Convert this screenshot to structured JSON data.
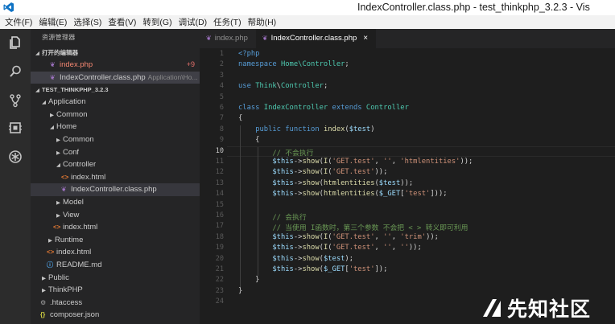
{
  "window": {
    "title": "IndexController.class.php - test_thinkphp_3.2.3 - Vis"
  },
  "menu": [
    "文件(F)",
    "编辑(E)",
    "选择(S)",
    "查看(V)",
    "转到(G)",
    "调试(D)",
    "任务(T)",
    "帮助(H)"
  ],
  "activity_bar": [
    {
      "icon": "files-icon"
    },
    {
      "icon": "search-icon"
    },
    {
      "icon": "source-control-icon"
    },
    {
      "icon": "debug-icon"
    },
    {
      "icon": "extensions-icon"
    }
  ],
  "sidebar": {
    "header": "资源管理器",
    "open_editors": {
      "label": "打开的编辑器",
      "items": [
        {
          "name": "index.php",
          "badge": "9",
          "desc": ""
        },
        {
          "name": "IndexController.class.php",
          "badge": "",
          "desc": "Application\\Ho..."
        }
      ]
    },
    "project": {
      "label": "TEST_THINKPHP_3.2.3",
      "tree": [
        {
          "name": "Application",
          "depth": 1,
          "type": "folder-open"
        },
        {
          "name": "Common",
          "depth": 2,
          "type": "folder"
        },
        {
          "name": "Home",
          "depth": 2,
          "type": "folder-open"
        },
        {
          "name": "Common",
          "depth": 3,
          "type": "folder"
        },
        {
          "name": "Conf",
          "depth": 3,
          "type": "folder"
        },
        {
          "name": "Controller",
          "depth": 3,
          "type": "folder-open"
        },
        {
          "name": "index.html",
          "depth": 4,
          "type": "html"
        },
        {
          "name": "IndexController.class.php",
          "depth": 4,
          "type": "php",
          "selected": true
        },
        {
          "name": "Model",
          "depth": 3,
          "type": "folder"
        },
        {
          "name": "View",
          "depth": 3,
          "type": "folder"
        },
        {
          "name": "index.html",
          "depth": 3,
          "type": "html"
        },
        {
          "name": "Runtime",
          "depth": 2,
          "type": "folder"
        },
        {
          "name": "index.html",
          "depth": 2,
          "type": "html"
        },
        {
          "name": "README.md",
          "depth": 2,
          "type": "info"
        },
        {
          "name": "Public",
          "depth": 1,
          "type": "folder"
        },
        {
          "name": "ThinkPHP",
          "depth": 1,
          "type": "folder"
        },
        {
          "name": ".htaccess",
          "depth": 1,
          "type": "gear"
        },
        {
          "name": "composer.json",
          "depth": 1,
          "type": "json"
        }
      ]
    }
  },
  "tabs": [
    {
      "label": "index.php",
      "active": false
    },
    {
      "label": "IndexController.class.php",
      "active": true,
      "close": "×"
    }
  ],
  "editor": {
    "current_line": 10,
    "lines": [
      [
        [
          "k",
          "<?php"
        ]
      ],
      [
        [
          "k",
          "namespace "
        ],
        [
          "n",
          "Home\\Controller"
        ],
        [
          "t",
          ";"
        ]
      ],
      [],
      [
        [
          "k",
          "use "
        ],
        [
          "n",
          "Think"
        ],
        [
          "t",
          "\\"
        ],
        [
          "n",
          "Controller"
        ],
        [
          "t",
          ";"
        ]
      ],
      [],
      [
        [
          "k",
          "class "
        ],
        [
          "n",
          "IndexController "
        ],
        [
          "k",
          "extends "
        ],
        [
          "n",
          "Controller"
        ]
      ],
      [
        [
          "t",
          "{"
        ]
      ],
      [
        [
          "t",
          "    "
        ],
        [
          "k",
          "public function "
        ],
        [
          "f",
          "index"
        ],
        [
          "t",
          "("
        ],
        [
          "v",
          "$test"
        ],
        [
          "t",
          ")"
        ]
      ],
      [
        [
          "t",
          "    {"
        ]
      ],
      [
        [
          "t",
          "        "
        ],
        [
          "c",
          "// 不会执行"
        ]
      ],
      [
        [
          "t",
          "        "
        ],
        [
          "v",
          "$this"
        ],
        [
          "t",
          "->"
        ],
        [
          "f",
          "show"
        ],
        [
          "t",
          "("
        ],
        [
          "f",
          "I"
        ],
        [
          "t",
          "("
        ],
        [
          "s",
          "'GET.test'"
        ],
        [
          "t",
          ", "
        ],
        [
          "s",
          "''"
        ],
        [
          "t",
          ", "
        ],
        [
          "s",
          "'htmlentities'"
        ],
        [
          "t",
          "));"
        ]
      ],
      [
        [
          "t",
          "        "
        ],
        [
          "v",
          "$this"
        ],
        [
          "t",
          "->"
        ],
        [
          "f",
          "show"
        ],
        [
          "t",
          "("
        ],
        [
          "f",
          "I"
        ],
        [
          "t",
          "("
        ],
        [
          "s",
          "'GET.test'"
        ],
        [
          "t",
          "));"
        ]
      ],
      [
        [
          "t",
          "        "
        ],
        [
          "v",
          "$this"
        ],
        [
          "t",
          "->"
        ],
        [
          "f",
          "show"
        ],
        [
          "t",
          "("
        ],
        [
          "f",
          "htmlentities"
        ],
        [
          "t",
          "("
        ],
        [
          "v",
          "$test"
        ],
        [
          "t",
          "));"
        ]
      ],
      [
        [
          "t",
          "        "
        ],
        [
          "v",
          "$this"
        ],
        [
          "t",
          "->"
        ],
        [
          "f",
          "show"
        ],
        [
          "t",
          "("
        ],
        [
          "f",
          "htmlentities"
        ],
        [
          "t",
          "("
        ],
        [
          "v",
          "$_GET"
        ],
        [
          "t",
          "["
        ],
        [
          "s",
          "'test'"
        ],
        [
          "t",
          "]));"
        ]
      ],
      [],
      [
        [
          "t",
          "        "
        ],
        [
          "c",
          "// 会执行"
        ]
      ],
      [
        [
          "t",
          "        "
        ],
        [
          "c",
          "// 当使用 I函数时，第三个参数 不会把 < > 转义即可利用"
        ]
      ],
      [
        [
          "t",
          "        "
        ],
        [
          "v",
          "$this"
        ],
        [
          "t",
          "->"
        ],
        [
          "f",
          "show"
        ],
        [
          "t",
          "("
        ],
        [
          "f",
          "I"
        ],
        [
          "t",
          "("
        ],
        [
          "s",
          "'GET.test'"
        ],
        [
          "t",
          ", "
        ],
        [
          "s",
          "''"
        ],
        [
          "t",
          ", "
        ],
        [
          "s",
          "'trim'"
        ],
        [
          "t",
          "));"
        ]
      ],
      [
        [
          "t",
          "        "
        ],
        [
          "v",
          "$this"
        ],
        [
          "t",
          "->"
        ],
        [
          "f",
          "show"
        ],
        [
          "t",
          "("
        ],
        [
          "f",
          "I"
        ],
        [
          "t",
          "("
        ],
        [
          "s",
          "'GET.test'"
        ],
        [
          "t",
          ", "
        ],
        [
          "s",
          "''"
        ],
        [
          "t",
          ", "
        ],
        [
          "s",
          "''"
        ],
        [
          "t",
          "));"
        ]
      ],
      [
        [
          "t",
          "        "
        ],
        [
          "v",
          "$this"
        ],
        [
          "t",
          "->"
        ],
        [
          "f",
          "show"
        ],
        [
          "t",
          "("
        ],
        [
          "v",
          "$test"
        ],
        [
          "t",
          ");"
        ]
      ],
      [
        [
          "t",
          "        "
        ],
        [
          "v",
          "$this"
        ],
        [
          "t",
          "->"
        ],
        [
          "f",
          "show"
        ],
        [
          "t",
          "("
        ],
        [
          "v",
          "$_GET"
        ],
        [
          "t",
          "["
        ],
        [
          "s",
          "'test'"
        ],
        [
          "t",
          "]);"
        ]
      ],
      [
        [
          "t",
          "    }"
        ]
      ],
      [
        [
          "t",
          "}"
        ]
      ],
      []
    ]
  },
  "watermark": {
    "text": "先知社区"
  }
}
